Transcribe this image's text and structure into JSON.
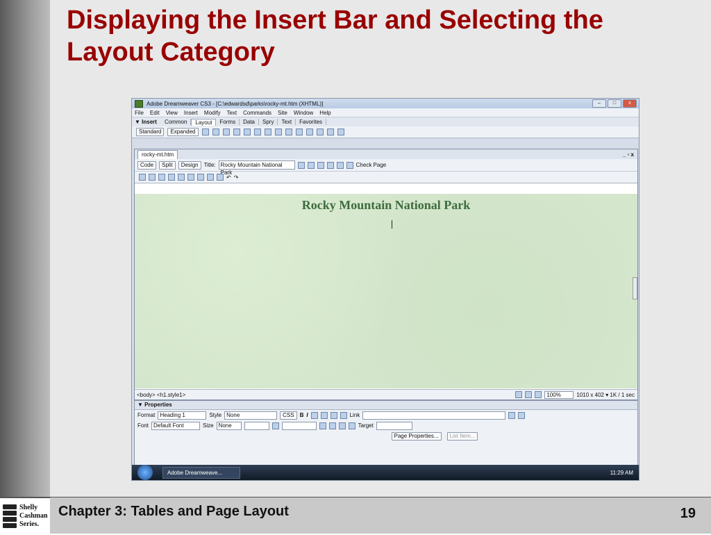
{
  "slide": {
    "title": "Displaying the Insert Bar and Selecting the Layout Category",
    "footer_title": "Chapter 3: Tables and Page Layout",
    "page_number": "19",
    "logo_lines": [
      "Shelly",
      "Cashman",
      "Series."
    ]
  },
  "app": {
    "window_title": "Adobe Dreamweaver CS3 - [C:\\edwardsd\\parks\\rocky-mt.htm (XHTML)]",
    "menu": [
      "File",
      "Edit",
      "View",
      "Insert",
      "Modify",
      "Text",
      "Commands",
      "Site",
      "Window",
      "Help"
    ],
    "insert_bar": {
      "label": "▼ Insert",
      "tabs": [
        "Common",
        "Layout",
        "Forms",
        "Data",
        "Spry",
        "Text",
        "Favorites"
      ],
      "active_tab": "Layout",
      "mode_buttons": [
        "Standard",
        "Expanded"
      ]
    },
    "document": {
      "tab": "rocky-mt.htm",
      "window_controls": "_ ▫ x",
      "view_buttons": [
        "Code",
        "Split",
        "Design"
      ],
      "title_label": "Title:",
      "title_value": "Rocky Mountain National Park",
      "check_page": "Check Page",
      "heading": "Rocky Mountain National Park",
      "status_path": "<body> <h1.style1>",
      "zoom": "100%",
      "size_info": "1010 x 402 ▾ 1K / 1 sec"
    },
    "properties": {
      "header": "▼ Properties",
      "format_label": "Format",
      "format_value": "Heading 1",
      "style_label": "Style",
      "style_value": "None",
      "css_button": "CSS",
      "bold": "B",
      "italic": "I",
      "link_label": "Link",
      "font_label": "Font",
      "font_value": "Default Font",
      "size_label": "Size",
      "size_value": "None",
      "target_label": "Target",
      "page_properties": "Page Properties...",
      "list_item": "List Item..."
    },
    "taskbar": {
      "item": "Adobe Dreamweave...",
      "clock": "11:29 AM"
    }
  }
}
